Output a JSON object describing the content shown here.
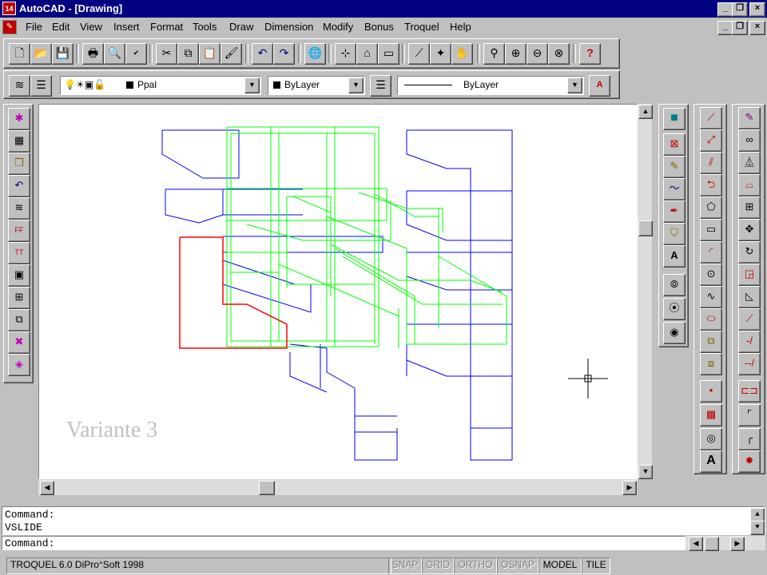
{
  "app": {
    "icon_text": "14",
    "title": "AutoCAD - [Drawing]"
  },
  "menu": [
    "File",
    "Edit",
    "View",
    "Insert",
    "Format",
    "Tools",
    "Draw",
    "Dimension",
    "Modify",
    "Bonus",
    "Troquel",
    "Help"
  ],
  "layer_bar": {
    "layer_name": "Ppal",
    "color_value": "ByLayer",
    "linetype_value": "ByLayer"
  },
  "drawing": {
    "annotation": "Variante 3",
    "colors": {
      "blue": "#0000ff",
      "green": "#00ff00",
      "red": "#ff0000",
      "annotation": "#c0c0c0"
    }
  },
  "command": {
    "history": [
      "Command:",
      "VSLIDE"
    ],
    "prompt": "Command:"
  },
  "status": {
    "info": "TROQUEL 6.0 DiPro°Soft 1998",
    "snap": "SNAP",
    "grid": "GRID",
    "ortho": "ORTHO",
    "osnap": "OSNAP",
    "model": "MODEL",
    "tile": "TILE"
  },
  "icons": {
    "standard_toolbar": [
      "new-icon",
      "open-icon",
      "save-icon",
      "print-icon",
      "print-preview-icon",
      "spell-check-icon",
      "cut-icon",
      "copy-icon",
      "paste-icon",
      "match-properties-icon",
      "undo-icon",
      "redo-icon",
      "launch-browser-icon",
      "tracking-icon",
      "object-snap-icon",
      "ucs-icon",
      "inquiry-icon",
      "redraw-icon",
      "pan-icon",
      "zoom-realtime-icon",
      "zoom-window-icon",
      "zoom-previous-icon",
      "help-icon"
    ],
    "left_toolbar": [
      "star-tool-icon",
      "grid-tool-icon",
      "block-tool-icon",
      "undo-arrow-icon",
      "layers-tool-icon",
      "dim-ff-icon",
      "dim-tt-icon",
      "page-tool-icon",
      "table-tool-icon",
      "insert-tool-icon",
      "explode-tool-icon",
      "cube-tool-icon"
    ],
    "middle_toolbar": [
      "square-color-icon",
      "edit-box-icon",
      "pencil-icon",
      "sketch-icon",
      "pen-icon",
      "shield-icon",
      "style-icon",
      "circle-1-icon",
      "circle-2-icon",
      "circle-3-icon"
    ],
    "draw_toolbar": [
      "line-icon",
      "construction-line-icon",
      "multiline-icon",
      "polyline-icon",
      "polygon-icon",
      "rectangle-icon",
      "arc-icon",
      "circle-icon",
      "spline-icon",
      "ellipse-icon",
      "insert-block-icon",
      "make-block-icon",
      "point-icon",
      "hatch-icon",
      "region-icon",
      "multiline-text-icon"
    ],
    "modify_toolbar": [
      "erase-icon",
      "copy-object-icon",
      "mirror-icon",
      "offset-icon",
      "array-icon",
      "move-icon",
      "rotate-icon",
      "scale-icon",
      "stretch-icon",
      "lengthen-icon",
      "trim-icon",
      "extend-icon",
      "break-icon",
      "chamfer-icon",
      "fillet-icon",
      "explode-icon"
    ]
  }
}
